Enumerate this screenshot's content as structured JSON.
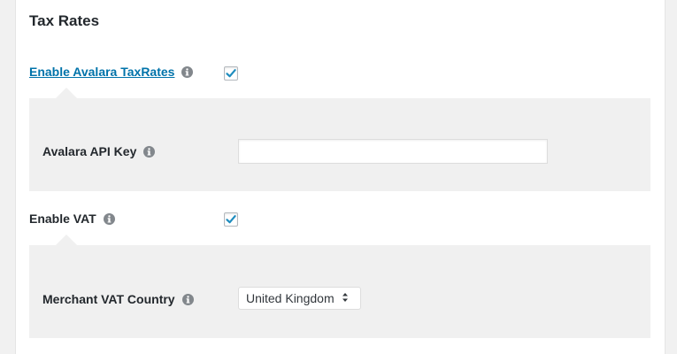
{
  "section": {
    "title": "Tax Rates"
  },
  "avalara": {
    "enable_label": "Enable Avalara TaxRates",
    "enabled": true,
    "api_key_label": "Avalara API Key",
    "api_key_value": ""
  },
  "vat": {
    "enable_label": "Enable VAT",
    "enabled": true,
    "merchant_country_label": "Merchant VAT Country",
    "merchant_country_value": "United Kingdom"
  },
  "icons": {
    "info": "info-icon",
    "checkmark": "checkmark-icon",
    "select_caret": "up-down-caret-icon"
  },
  "colors": {
    "link": "#0073aa",
    "checkmark": "#1e8cbe",
    "info_icon": "#82878c",
    "subpanel_bg": "#f0f0f0"
  }
}
